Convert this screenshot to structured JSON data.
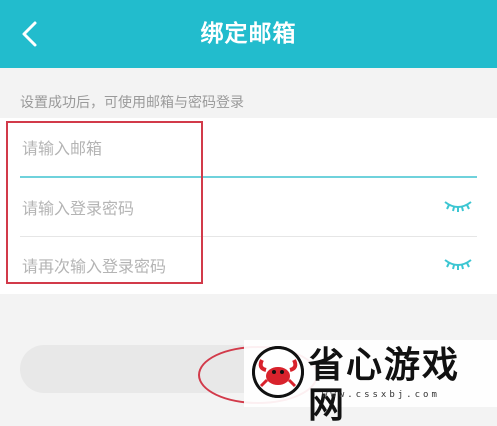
{
  "header": {
    "title": "绑定邮箱",
    "background_color": "#22bccd"
  },
  "hint": "设置成功后，可使用邮箱与密码登录",
  "form": {
    "email_placeholder": "请输入邮箱",
    "password_placeholder": "请输入登录密码",
    "confirm_placeholder": "请再次输入登录密码"
  },
  "icons": {
    "back": "chevron-left-icon",
    "password_toggle": "closed-eye-icon"
  },
  "watermark": {
    "text": "省心游戏网",
    "url": "www.cssxbj.com"
  },
  "annotation_color": "#d23a4a"
}
